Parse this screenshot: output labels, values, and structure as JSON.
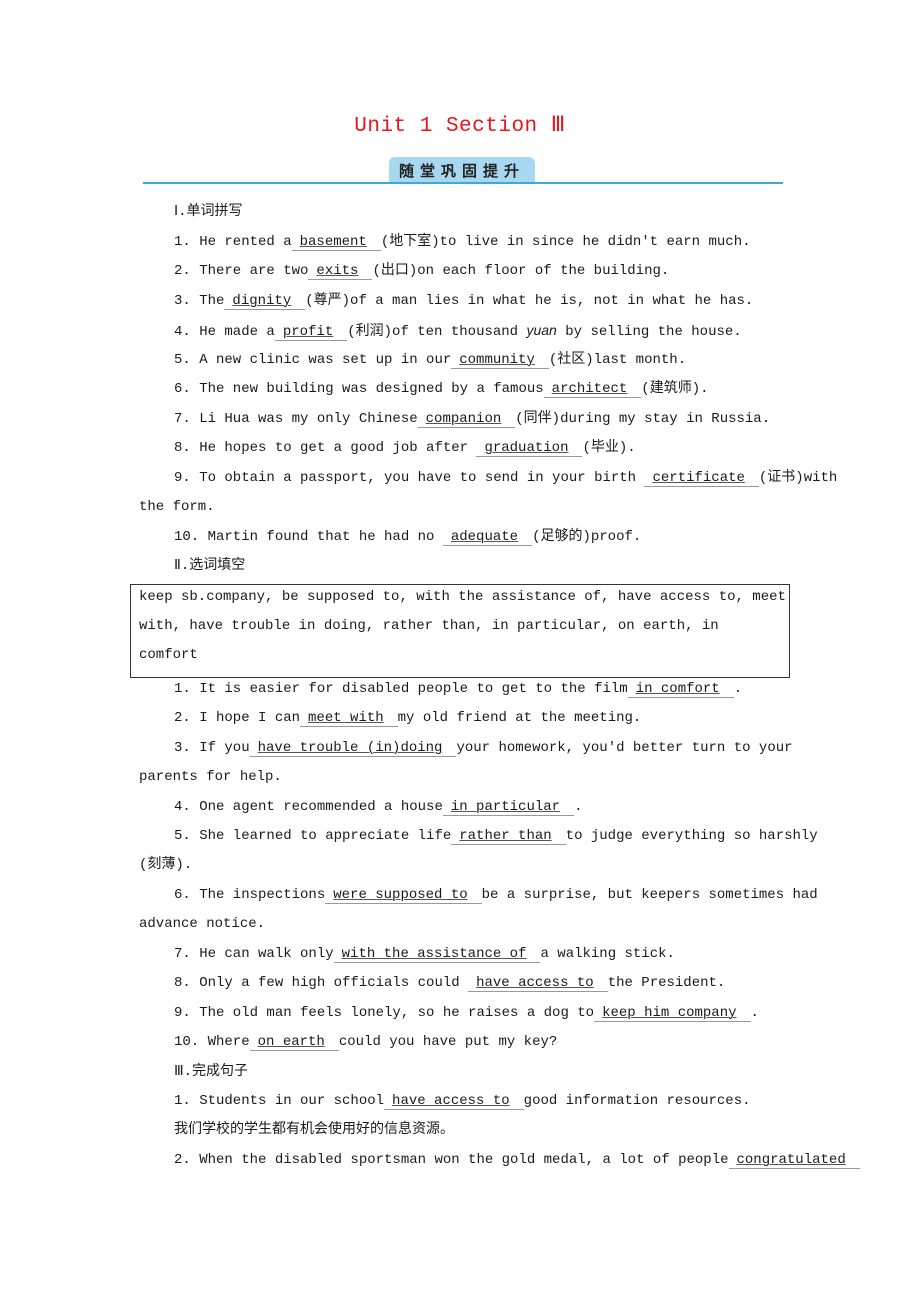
{
  "title": "Unit 1  Section Ⅲ",
  "banner": "随堂巩固提升",
  "colors": {
    "title": "#e8141a",
    "banner_bg": "#a8d8f0",
    "rule": "#3aa9e0"
  },
  "section1": {
    "heading": "Ⅰ.单词拼写",
    "items": [
      {
        "pre": "1. He rented a",
        "ans": "basement",
        "post": "(地下室)to live in since he didn't earn much."
      },
      {
        "pre": "2. There are two",
        "ans": "exits",
        "post": "(出口)on each floor of the building."
      },
      {
        "pre": "3. The",
        "ans": "dignity",
        "post": "(尊严)of a man lies in what he is, not in what he has."
      },
      {
        "pre": "4. He made a",
        "ans": "profit",
        "post": "(利润)of ten thousand ",
        "italic": "yuan",
        "post2": " by selling the house."
      },
      {
        "pre": "5. A new clinic was set up in our",
        "ans": "community",
        "post": "(社区)last month."
      },
      {
        "pre": "6. The new building was designed by a famous",
        "ans": "architect",
        "post": "(建筑师)."
      },
      {
        "pre": "7. Li Hua was my only Chinese",
        "ans": "companion",
        "post": "(同伴)during my stay in Russia."
      },
      {
        "pre": "8. He hopes to get a good job after ",
        "ans": "graduation",
        "post": "(毕业)."
      },
      {
        "pre": "9. To obtain a passport, you have to send in your birth ",
        "ans": "certificate",
        "post": "(证书)with",
        "cont": "the form."
      },
      {
        "pre": "10. Martin found that he had no ",
        "ans": "adequate",
        "post": "(足够的)proof."
      }
    ]
  },
  "section2": {
    "heading": "Ⅱ.选词填空",
    "box_lines": [
      "keep sb.company,  be supposed to,  with the assistance of,  have access to,  meet",
      "with,  have trouble   in  doing,  rather than,  in particular,  on earth,  in",
      "comfort"
    ],
    "items": [
      {
        "pre": "1. It is easier for disabled people to get to the film",
        "ans": "in comfort",
        "post": "."
      },
      {
        "pre": "2. I hope I can",
        "ans": "meet with",
        "post": "my old friend at the meeting."
      },
      {
        "pre": "3. If you",
        "ans": "have trouble (in)doing",
        "post": "your homework, you'd better turn to your",
        "cont": "parents for help."
      },
      {
        "pre": "4. One agent recommended a house",
        "ans": "in particular",
        "post": "."
      },
      {
        "pre": "5. She learned to appreciate life",
        "ans": "rather than",
        "post": "to judge everything so harshly",
        "cont": "(刻薄)."
      },
      {
        "pre": "6. The inspections",
        "ans": "were supposed to",
        "post": "be a surprise, but keepers sometimes had",
        "cont": "advance notice."
      },
      {
        "pre": "7. He can walk only",
        "ans": "with the assistance of",
        "post": "a walking stick."
      },
      {
        "pre": "8. Only a few high officials could ",
        "ans": "have access to",
        "post": "the President."
      },
      {
        "pre": "9. The old man feels lonely, so he raises a dog to",
        "ans": "keep him company",
        "post": "."
      },
      {
        "pre": "10. Where",
        "ans": "on earth",
        "post": "could you have put my key?"
      }
    ]
  },
  "section3": {
    "heading": "Ⅲ.完成句子",
    "items": [
      {
        "pre": "1. Students in our school",
        "ans": "have access to",
        "post": "good information resources.",
        "cont": "我们学校的学生都有机会使用好的信息资源。"
      },
      {
        "pre": "2. When the disabled sportsman won the gold medal, a lot of people",
        "ans": "congratulated",
        "post": ""
      }
    ]
  }
}
